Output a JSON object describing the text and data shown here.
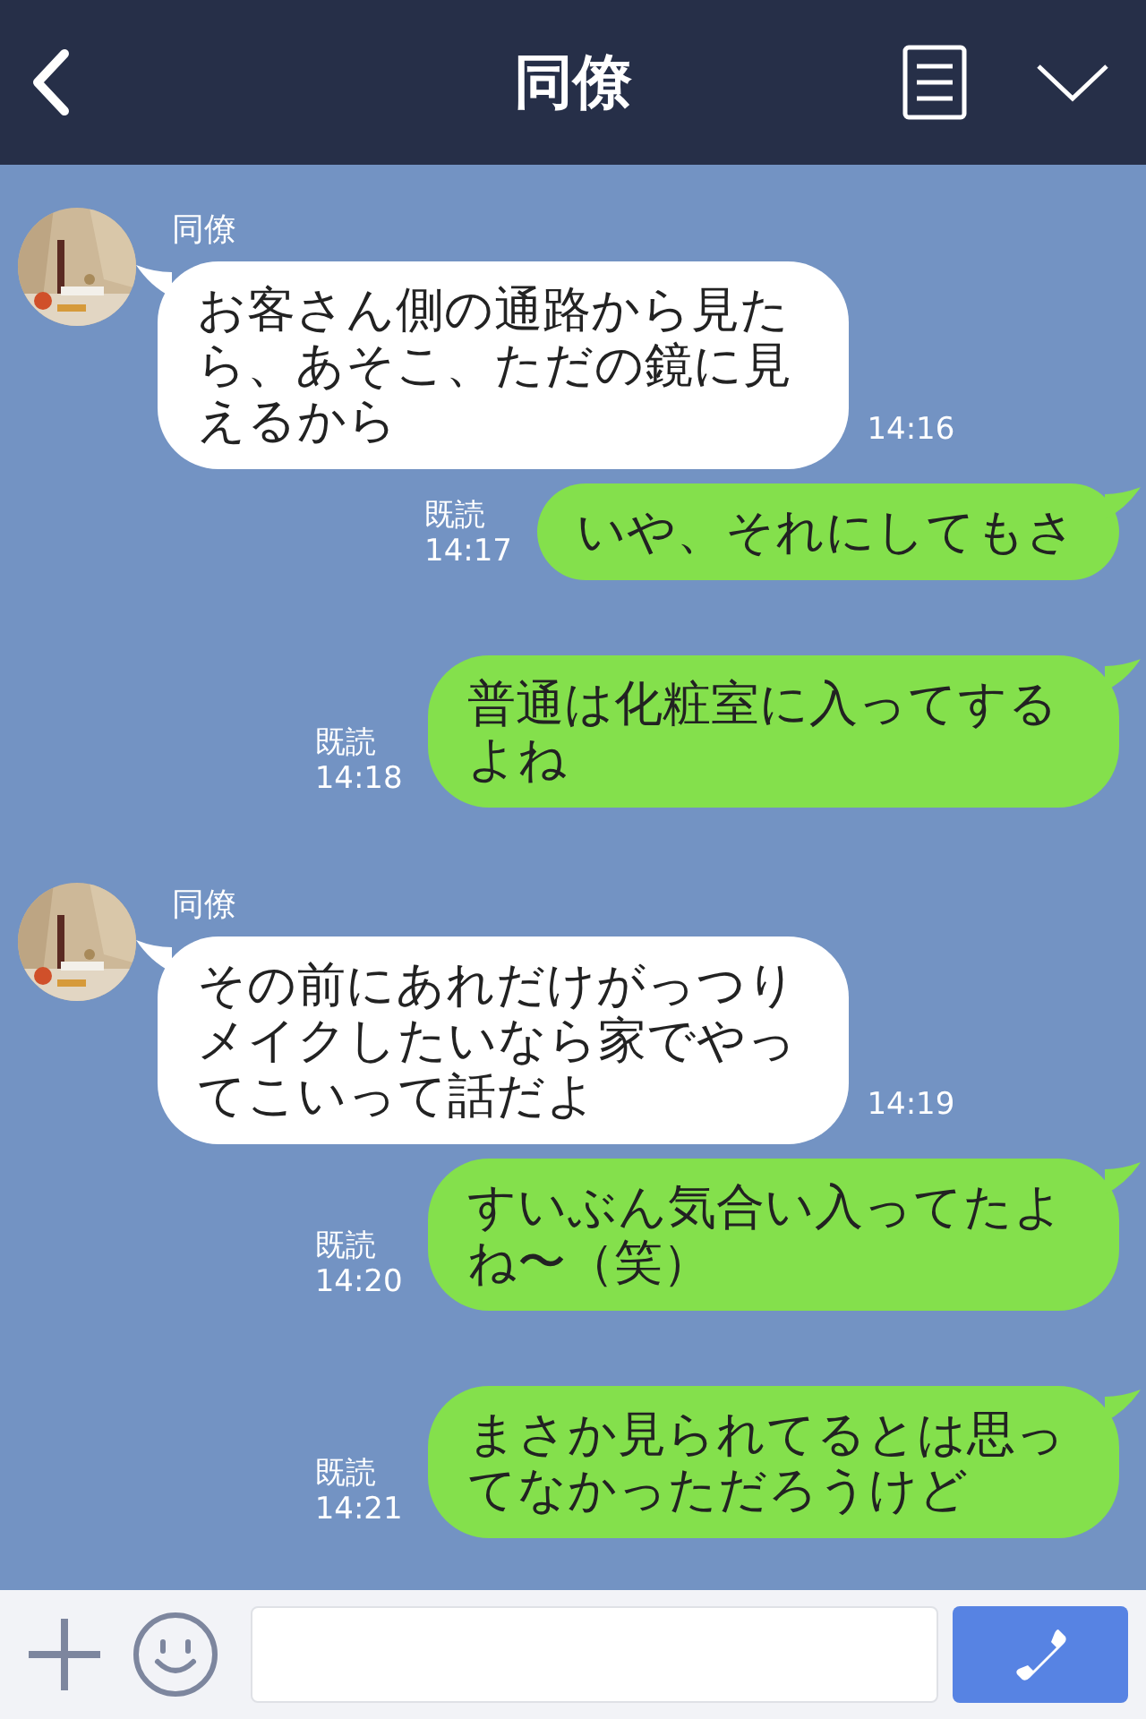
{
  "header": {
    "title": "同僚"
  },
  "messages": [
    {
      "kind": "incoming",
      "sender": "同僚",
      "text": "お客さん側の通路から見たら、あそこ、ただの鏡に見えるから",
      "time": "14:16"
    },
    {
      "kind": "outgoing",
      "read": "既読",
      "text": "いや、それにしてもさ",
      "time": "14:17"
    },
    {
      "kind": "outgoing",
      "read": "既読",
      "text": "普通は化粧室に入ってするよね",
      "time": "14:18"
    },
    {
      "kind": "incoming",
      "sender": "同僚",
      "text": "その前にあれだけがっつりメイクしたいなら家でやってこいって話だよ",
      "time": "14:19"
    },
    {
      "kind": "outgoing",
      "read": "既読",
      "text": "すいぶん気合い入ってたよね〜（笑）",
      "time": "14:20"
    },
    {
      "kind": "outgoing",
      "read": "既読",
      "text": "まさか見られてるとは思ってなかっただろうけど",
      "time": "14:21"
    }
  ]
}
